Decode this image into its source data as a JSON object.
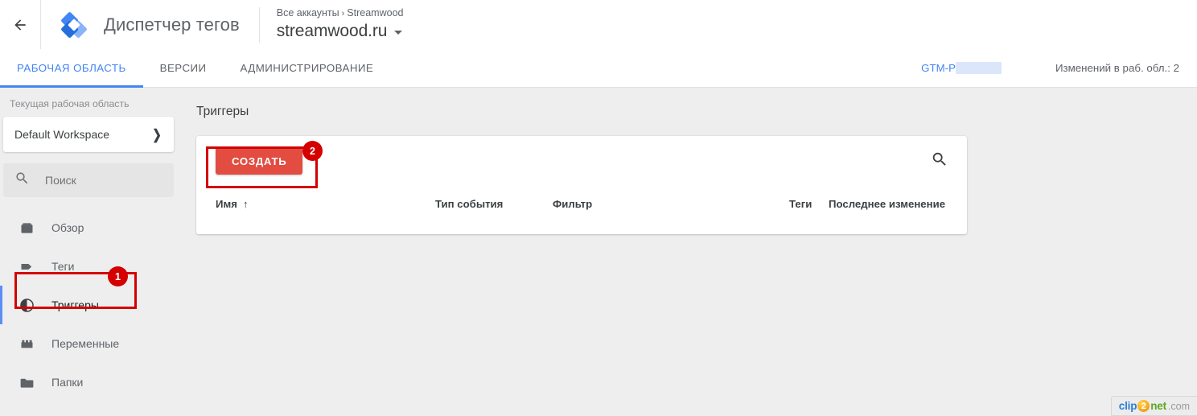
{
  "header": {
    "back_icon": "back-arrow-icon",
    "logo_icon": "google-tag-manager-logo",
    "product_title": "Диспетчер тегов",
    "breadcrumb_root": "Все аккаунты",
    "breadcrumb_sep": "›",
    "breadcrumb_account": "Streamwood",
    "container_name": "streamwood.ru",
    "container_caret_icon": "caret-down-icon"
  },
  "tabbar": {
    "tabs": [
      {
        "label": "РАБОЧАЯ ОБЛАСТЬ",
        "active": true
      },
      {
        "label": "ВЕРСИИ",
        "active": false
      },
      {
        "label": "АДМИНИСТРИРОВАНИЕ",
        "active": false
      }
    ],
    "container_id": "GTM-P",
    "container_id_redacted": true,
    "workspace_changes": "Изменений в раб. обл.: 2"
  },
  "sidebar": {
    "workspace_label": "Текущая рабочая область",
    "workspace_name": "Default Workspace",
    "workspace_chevron_icon": "chevron-right-icon",
    "search": {
      "icon": "search-icon",
      "placeholder": "Поиск",
      "value": ""
    },
    "items": [
      {
        "label": "Обзор",
        "icon": "overview-box-icon",
        "active": false
      },
      {
        "label": "Теги",
        "icon": "tag-icon",
        "active": false
      },
      {
        "label": "Триггеры",
        "icon": "trigger-contrast-circle-icon",
        "active": true
      },
      {
        "label": "Переменные",
        "icon": "variables-brick-icon",
        "active": false
      },
      {
        "label": "Папки",
        "icon": "folder-icon",
        "active": false
      }
    ]
  },
  "main": {
    "page_title": "Триггеры",
    "create_button": "СОЗДАТЬ",
    "search_icon": "search-icon",
    "table": {
      "columns": [
        {
          "label": "Имя",
          "sorted": true,
          "sort_icon": "sort-asc-arrow-icon"
        },
        {
          "label": "Тип события",
          "sorted": false
        },
        {
          "label": "Фильтр",
          "sorted": false
        },
        {
          "label": "Теги",
          "sorted": false
        },
        {
          "label": "Последнее изменение",
          "sorted": false
        }
      ],
      "rows": []
    }
  },
  "annotations": {
    "step_one": "1",
    "step_two": "2",
    "color": "#d40000"
  },
  "watermark": {
    "clip": "clip",
    "two": "2",
    "net": "net",
    "com": ".com"
  }
}
